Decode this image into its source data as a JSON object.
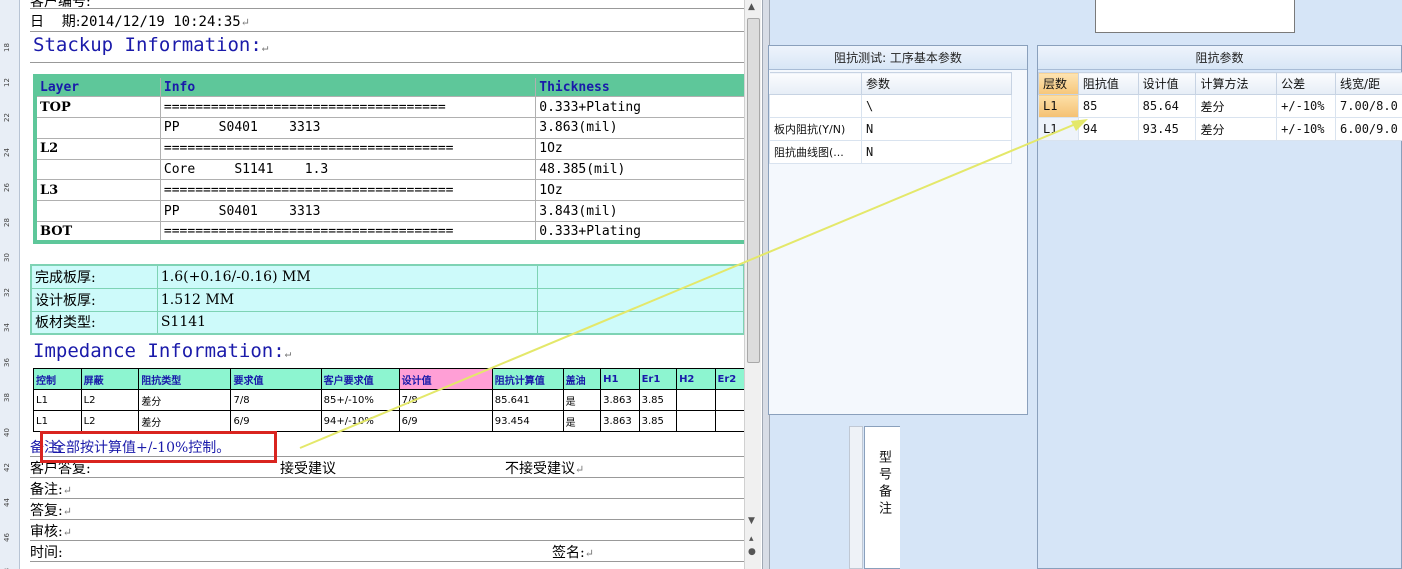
{
  "doc": {
    "cut_top_line": "客户编号:",
    "date_label": "日    期:",
    "date_value": "2014/12/19 10:24:35",
    "stackup_title": "Stackup Information:",
    "stackup": {
      "headers": [
        "Layer",
        "Info",
        "Thickness"
      ],
      "rows": [
        {
          "layer": "TOP",
          "info": "====================================",
          "thickness": "0.333+Plating"
        },
        {
          "layer": "",
          "info": "PP     S0401    3313",
          "thickness": "3.863(mil)"
        },
        {
          "layer": "L2",
          "info": "=====================================",
          "thickness": "1Oz"
        },
        {
          "layer": "",
          "info": "Core     S1141    1.3",
          "thickness": "48.385(mil)"
        },
        {
          "layer": "L3",
          "info": "=====================================",
          "thickness": "1Oz"
        },
        {
          "layer": "",
          "info": "PP     S0401    3313",
          "thickness": "3.843(mil)"
        },
        {
          "layer": "BOT",
          "info": "=====================================",
          "thickness": "0.333+Plating"
        }
      ]
    },
    "board": [
      {
        "label": "完成板厚:",
        "value": "1.6(+0.16/-0.16) MM"
      },
      {
        "label": "设计板厚:",
        "value": "1.512 MM"
      },
      {
        "label": "板材类型:",
        "value": "S1141"
      }
    ],
    "impedance_title": "Impedance Information:",
    "impedance": {
      "headers": [
        "控制",
        "屏蔽",
        "阻抗类型",
        "要求值",
        "客户要求值",
        "设计值",
        "阻抗计算值",
        "盖油",
        "H1",
        "Er1",
        "H2",
        "Er2"
      ],
      "rows": [
        [
          "L1",
          "L2",
          "差分",
          "7/8",
          "85+/-10%",
          "7/8",
          "85.641",
          "是",
          "3.863",
          "3.85",
          "",
          ""
        ],
        [
          "L1",
          "L2",
          "差分",
          "6/9",
          "94+/-10%",
          "6/9",
          "93.454",
          "是",
          "3.863",
          "3.85",
          "",
          ""
        ]
      ]
    },
    "remark_label": "备注:",
    "remark_text": "全部按计算值+/-10%控制。",
    "customer_reply_label": "客户答复:",
    "accept": "接受建议",
    "reject": "不接受建议",
    "note_label": "备注:",
    "reply_label": "答复:",
    "audit_label": "审核:",
    "time_label": "时间:",
    "sign_label": "签名:",
    "ruler_numbers": [
      "18",
      "12",
      "22",
      "24",
      "26",
      "28",
      "30",
      "32",
      "34",
      "36",
      "38",
      "40",
      "42",
      "44",
      "46",
      "48"
    ]
  },
  "app": {
    "process_panel": {
      "title": "阻抗测试: 工序基本参数",
      "header": "参数",
      "rows": [
        {
          "name": "",
          "value": "\\"
        },
        {
          "name": "板内阻抗(Y/N)",
          "value": "N"
        },
        {
          "name": "阻抗曲线图(...",
          "value": "N"
        }
      ]
    },
    "impedance_panel": {
      "title": "阻抗参数",
      "headers": [
        "层数",
        "阻抗值",
        "设计值",
        "计算方法",
        "公差",
        "线宽/距"
      ],
      "rows": [
        [
          "L1",
          "85",
          "85.64",
          "差分",
          "+/-10%",
          "7.00/8.0"
        ],
        [
          "L1",
          "94",
          "93.45",
          "差分",
          "+/-10%",
          "6.00/9.0"
        ]
      ]
    },
    "model_note_label": "型号备注"
  },
  "colors": {
    "stackup_green": "#5ec79a",
    "board_cyan": "#cdfafa",
    "heading_blue": "#1a1aaa",
    "highlight_red": "#d9241f",
    "arrow_yellow": "#e4e86a",
    "app_bg": "#d6e5f7"
  }
}
